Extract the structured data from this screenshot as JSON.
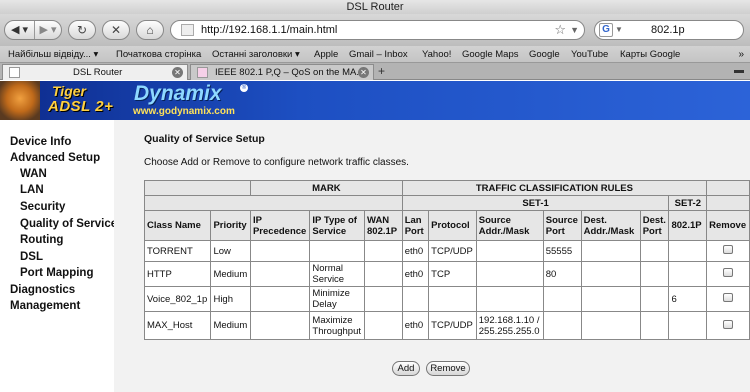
{
  "window": {
    "title": "DSL Router"
  },
  "toolbar": {
    "url": "http://192.168.1.1/main.html",
    "search_value": "802.1p",
    "search_engine_letter": "G"
  },
  "bookmarks": [
    "Найбільш відвіду... ▾",
    "Початкова сторінка",
    "Останні заголовки ▾",
    "Apple",
    "Gmail – Inbox",
    "Yahoo!",
    "Google Maps",
    "Google",
    "YouTube",
    "Карты Google"
  ],
  "bookmarks_more": "»",
  "tabs": [
    {
      "title": "DSL Router",
      "active": true
    },
    {
      "title": "IEEE 802.1 P,Q – QoS on the MA...",
      "active": false
    }
  ],
  "banner": {
    "brand_top": "Tiger",
    "brand_bottom": "ADSL 2+",
    "logo_text": "Dynamix",
    "website": "www.godynamix.com"
  },
  "sidebar": {
    "items": [
      {
        "label": "Device Info",
        "level": "top"
      },
      {
        "label": "Advanced Setup",
        "level": "top"
      },
      {
        "label": "WAN",
        "level": "sub"
      },
      {
        "label": "LAN",
        "level": "sub"
      },
      {
        "label": "Security",
        "level": "sub"
      },
      {
        "label": "Quality of Service",
        "level": "sub"
      },
      {
        "label": "Routing",
        "level": "sub"
      },
      {
        "label": "DSL",
        "level": "sub"
      },
      {
        "label": "Port Mapping",
        "level": "sub"
      },
      {
        "label": "Diagnostics",
        "level": "top"
      },
      {
        "label": "Management",
        "level": "top"
      }
    ]
  },
  "main": {
    "heading": "Quality of Service Setup",
    "description": "Choose Add or Remove to configure network traffic classes.",
    "group_headers": {
      "mark": "MARK",
      "rules": "TRAFFIC CLASSIFICATION RULES",
      "set1": "SET-1",
      "set2": "SET-2"
    },
    "columns": [
      "Class Name",
      "Priority",
      "IP Precedence",
      "IP Type of Service",
      "WAN 802.1P",
      "Lan Port",
      "Protocol",
      "Source Addr./Mask",
      "Source Port",
      "Dest. Addr./Mask",
      "Dest. Port",
      "802.1P",
      "Remove"
    ],
    "rows": [
      {
        "class_name": "TORRENT",
        "priority": "Low",
        "ip_precedence": "",
        "ip_tos": "",
        "wan_8021p": "",
        "lan_port": "eth0",
        "protocol": "TCP/UDP",
        "src_addr": "",
        "src_port": "55555",
        "dst_addr": "",
        "dst_port": "",
        "set2_8021p": ""
      },
      {
        "class_name": "HTTP",
        "priority": "Medium",
        "ip_precedence": "",
        "ip_tos": "Normal Service",
        "wan_8021p": "",
        "lan_port": "eth0",
        "protocol": "TCP",
        "src_addr": "",
        "src_port": "80",
        "dst_addr": "",
        "dst_port": "",
        "set2_8021p": ""
      },
      {
        "class_name": "Voice_802_1p",
        "priority": "High",
        "ip_precedence": "",
        "ip_tos": "Minimize Delay",
        "wan_8021p": "",
        "lan_port": "",
        "protocol": "",
        "src_addr": "",
        "src_port": "",
        "dst_addr": "",
        "dst_port": "",
        "set2_8021p": "6"
      },
      {
        "class_name": "MAX_Host",
        "priority": "Medium",
        "ip_precedence": "",
        "ip_tos": "Maximize Throughput",
        "wan_8021p": "",
        "lan_port": "eth0",
        "protocol": "TCP/UDP",
        "src_addr": "192.168.1.10 / 255.255.255.0",
        "src_port": "",
        "dst_addr": "",
        "dst_port": "",
        "set2_8021p": ""
      }
    ],
    "buttons": {
      "add": "Add",
      "remove": "Remove"
    }
  }
}
